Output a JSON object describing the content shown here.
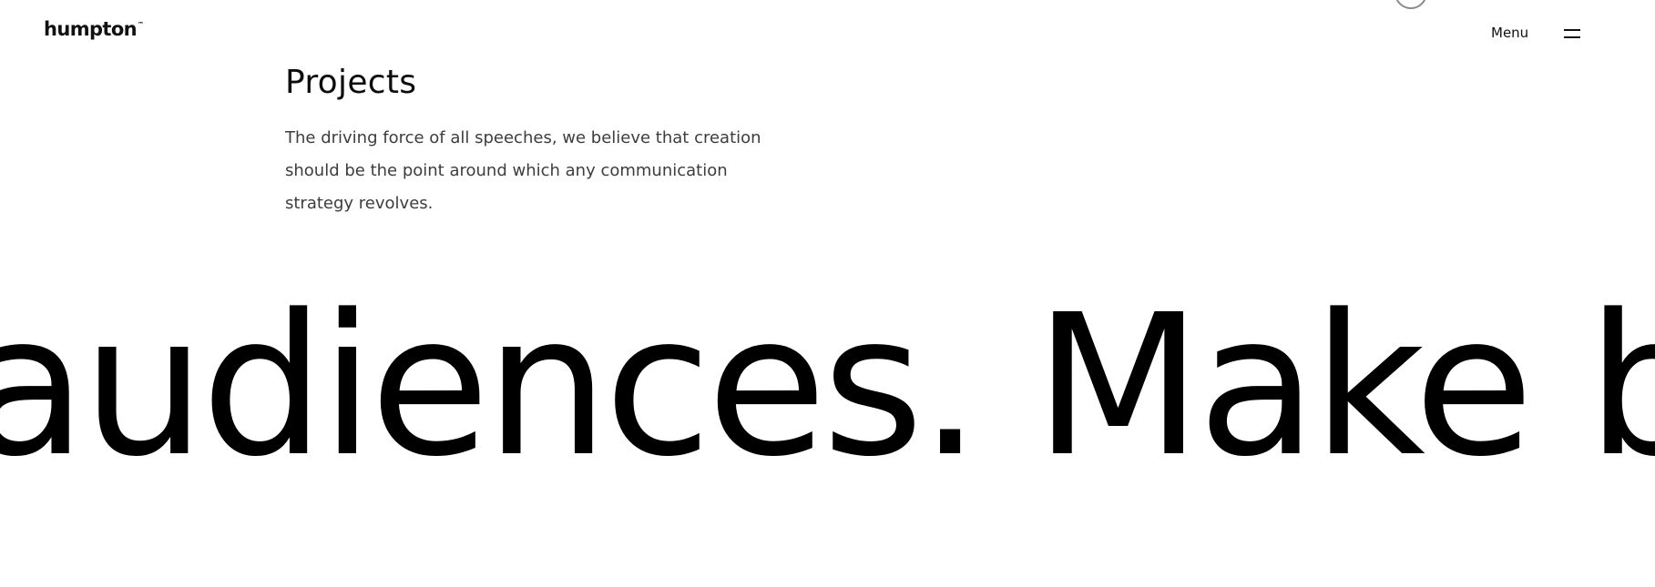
{
  "header": {
    "logo_text": "humpton",
    "logo_mark": "™",
    "menu_label": "Menu",
    "menu_icon": "hamburger-icon"
  },
  "intro": {
    "title": "Projects",
    "description": "The driving force of all speeches, we believe that creation should be the point around which any communication strategy revolves."
  },
  "marquee": {
    "text": "audiences. Make bro"
  }
}
